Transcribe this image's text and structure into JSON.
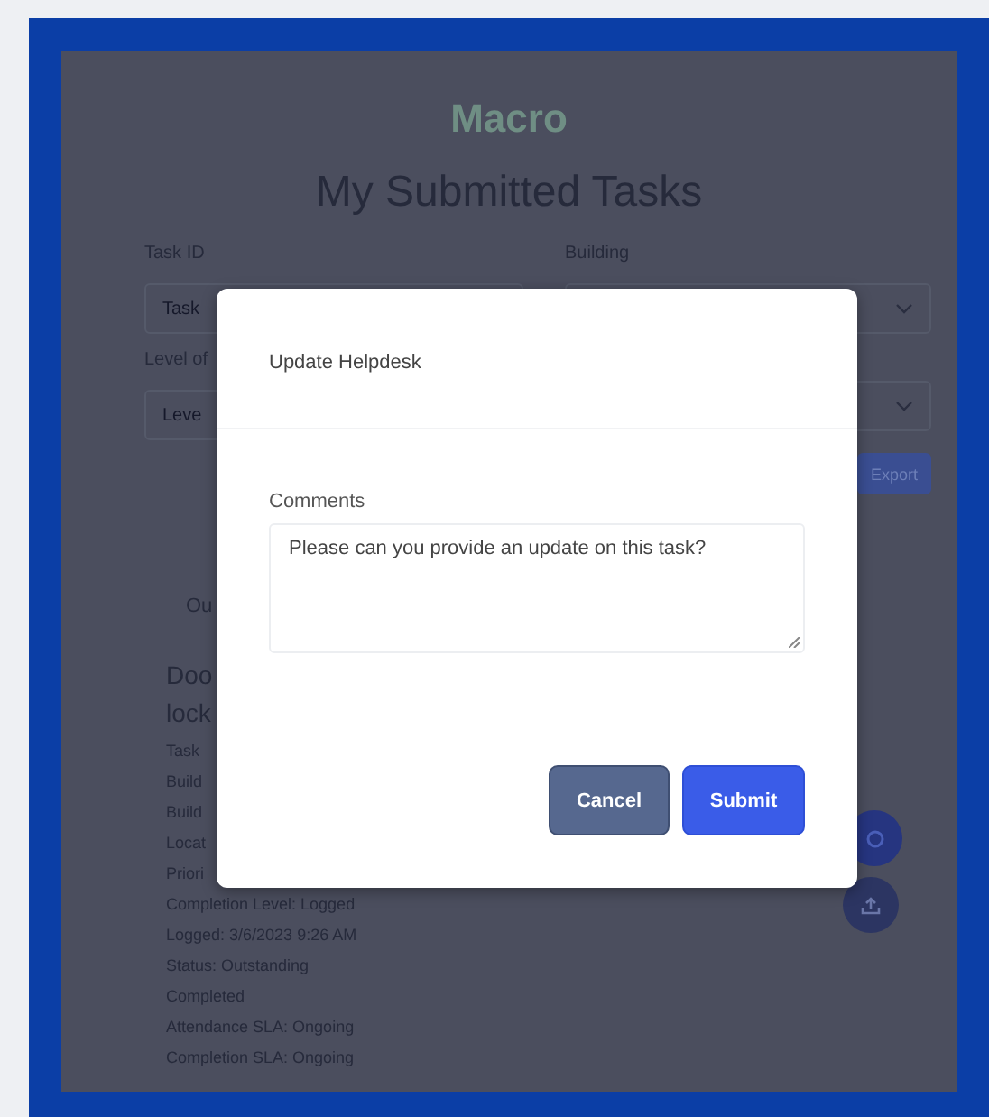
{
  "app": {
    "logo": "Macro",
    "title": "My Submitted Tasks"
  },
  "filters": [
    {
      "label": "Task ID",
      "placeholder": "Task",
      "kind": "text"
    },
    {
      "label": "Building",
      "kind": "select"
    },
    {
      "label": "Level of",
      "placeholder": "Leve",
      "kind": "text"
    },
    {
      "kind": "select"
    }
  ],
  "export_button": "Export",
  "section_tab": "Ou",
  "task": {
    "title_lines": [
      "Doo",
      "lock"
    ],
    "fields": [
      "Task",
      "Build",
      "Build",
      "Locat",
      "Priori",
      "Completion Level: Logged",
      "Logged: 3/6/2023 9:26 AM",
      "Status: Outstanding",
      "Completed",
      "Attendance SLA: Ongoing",
      "Completion SLA: Ongoing"
    ]
  },
  "floating_buttons": [
    {
      "kind": "ring"
    },
    {
      "kind": "upload"
    }
  ],
  "modal": {
    "title": "Update Helpdesk",
    "comments_label": "Comments",
    "comments_value": "Please can you provide an update on this task?",
    "buttons": [
      {
        "label": "Cancel",
        "kind": "secondary"
      },
      {
        "label": "Submit",
        "kind": "primary"
      }
    ]
  }
}
